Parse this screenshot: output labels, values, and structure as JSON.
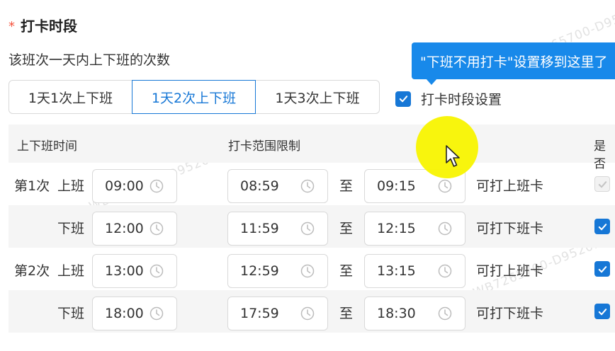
{
  "section": {
    "required_mark": "*",
    "title": "打卡时段"
  },
  "subtitle": "该班次一天内上下班的次数",
  "frequency_options": [
    {
      "label": "1天1次上下班",
      "selected": false
    },
    {
      "label": "1天2次上下班",
      "selected": true
    },
    {
      "label": "1天3次上下班",
      "selected": false
    }
  ],
  "period_setting": {
    "label": "打卡时段设置",
    "checked": true
  },
  "tooltip": "\"下班不用打卡\"设置移到这里了",
  "table": {
    "headers": {
      "time": "上下班时间",
      "range": "打卡范围限制",
      "required": "是否"
    },
    "to_label": "至",
    "rows": [
      {
        "group": "第1次",
        "kind": "上班",
        "time": "09:00",
        "start": "08:59",
        "end": "09:15",
        "can": "可打上班卡",
        "checked": true,
        "disabled": true
      },
      {
        "group": "",
        "kind": "下班",
        "time": "12:00",
        "start": "11:59",
        "end": "12:15",
        "can": "可打下班卡",
        "checked": true,
        "disabled": false
      },
      {
        "group": "第2次",
        "kind": "上班",
        "time": "13:00",
        "start": "12:59",
        "end": "13:15",
        "can": "可打上班卡",
        "checked": true,
        "disabled": false
      },
      {
        "group": "",
        "kind": "下班",
        "time": "18:00",
        "start": "17:59",
        "end": "18:30",
        "can": "可打下班卡",
        "checked": true,
        "disabled": false
      }
    ]
  },
  "watermark": "WB7265700-D9520NDC-2",
  "colors": {
    "accent": "#1677d6",
    "tooltip": "#1889ea",
    "required": "#f5533d",
    "cursor_highlight": "#f8f400"
  },
  "icons": {
    "checkbox": "check-icon",
    "time_input": "clock-icon",
    "pointer": "mouse-pointer-icon"
  }
}
